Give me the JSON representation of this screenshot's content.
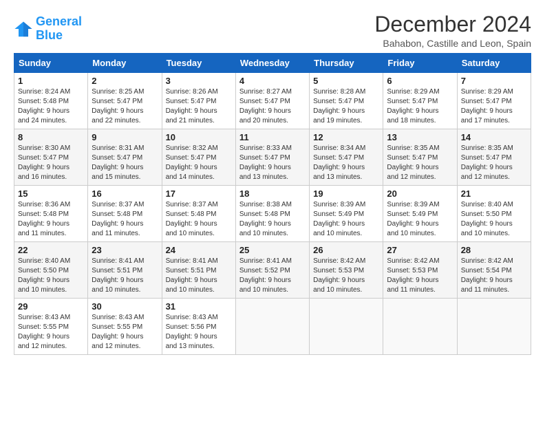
{
  "logo": {
    "line1": "General",
    "line2": "Blue"
  },
  "title": "December 2024",
  "subtitle": "Bahabon, Castille and Leon, Spain",
  "days_header": [
    "Sunday",
    "Monday",
    "Tuesday",
    "Wednesday",
    "Thursday",
    "Friday",
    "Saturday"
  ],
  "weeks": [
    [
      {
        "day": "1",
        "info": "Sunrise: 8:24 AM\nSunset: 5:48 PM\nDaylight: 9 hours\nand 24 minutes."
      },
      {
        "day": "2",
        "info": "Sunrise: 8:25 AM\nSunset: 5:47 PM\nDaylight: 9 hours\nand 22 minutes."
      },
      {
        "day": "3",
        "info": "Sunrise: 8:26 AM\nSunset: 5:47 PM\nDaylight: 9 hours\nand 21 minutes."
      },
      {
        "day": "4",
        "info": "Sunrise: 8:27 AM\nSunset: 5:47 PM\nDaylight: 9 hours\nand 20 minutes."
      },
      {
        "day": "5",
        "info": "Sunrise: 8:28 AM\nSunset: 5:47 PM\nDaylight: 9 hours\nand 19 minutes."
      },
      {
        "day": "6",
        "info": "Sunrise: 8:29 AM\nSunset: 5:47 PM\nDaylight: 9 hours\nand 18 minutes."
      },
      {
        "day": "7",
        "info": "Sunrise: 8:29 AM\nSunset: 5:47 PM\nDaylight: 9 hours\nand 17 minutes."
      }
    ],
    [
      {
        "day": "8",
        "info": "Sunrise: 8:30 AM\nSunset: 5:47 PM\nDaylight: 9 hours\nand 16 minutes."
      },
      {
        "day": "9",
        "info": "Sunrise: 8:31 AM\nSunset: 5:47 PM\nDaylight: 9 hours\nand 15 minutes."
      },
      {
        "day": "10",
        "info": "Sunrise: 8:32 AM\nSunset: 5:47 PM\nDaylight: 9 hours\nand 14 minutes."
      },
      {
        "day": "11",
        "info": "Sunrise: 8:33 AM\nSunset: 5:47 PM\nDaylight: 9 hours\nand 13 minutes."
      },
      {
        "day": "12",
        "info": "Sunrise: 8:34 AM\nSunset: 5:47 PM\nDaylight: 9 hours\nand 13 minutes."
      },
      {
        "day": "13",
        "info": "Sunrise: 8:35 AM\nSunset: 5:47 PM\nDaylight: 9 hours\nand 12 minutes."
      },
      {
        "day": "14",
        "info": "Sunrise: 8:35 AM\nSunset: 5:47 PM\nDaylight: 9 hours\nand 12 minutes."
      }
    ],
    [
      {
        "day": "15",
        "info": "Sunrise: 8:36 AM\nSunset: 5:48 PM\nDaylight: 9 hours\nand 11 minutes."
      },
      {
        "day": "16",
        "info": "Sunrise: 8:37 AM\nSunset: 5:48 PM\nDaylight: 9 hours\nand 11 minutes."
      },
      {
        "day": "17",
        "info": "Sunrise: 8:37 AM\nSunset: 5:48 PM\nDaylight: 9 hours\nand 10 minutes."
      },
      {
        "day": "18",
        "info": "Sunrise: 8:38 AM\nSunset: 5:48 PM\nDaylight: 9 hours\nand 10 minutes."
      },
      {
        "day": "19",
        "info": "Sunrise: 8:39 AM\nSunset: 5:49 PM\nDaylight: 9 hours\nand 10 minutes."
      },
      {
        "day": "20",
        "info": "Sunrise: 8:39 AM\nSunset: 5:49 PM\nDaylight: 9 hours\nand 10 minutes."
      },
      {
        "day": "21",
        "info": "Sunrise: 8:40 AM\nSunset: 5:50 PM\nDaylight: 9 hours\nand 10 minutes."
      }
    ],
    [
      {
        "day": "22",
        "info": "Sunrise: 8:40 AM\nSunset: 5:50 PM\nDaylight: 9 hours\nand 10 minutes."
      },
      {
        "day": "23",
        "info": "Sunrise: 8:41 AM\nSunset: 5:51 PM\nDaylight: 9 hours\nand 10 minutes."
      },
      {
        "day": "24",
        "info": "Sunrise: 8:41 AM\nSunset: 5:51 PM\nDaylight: 9 hours\nand 10 minutes."
      },
      {
        "day": "25",
        "info": "Sunrise: 8:41 AM\nSunset: 5:52 PM\nDaylight: 9 hours\nand 10 minutes."
      },
      {
        "day": "26",
        "info": "Sunrise: 8:42 AM\nSunset: 5:53 PM\nDaylight: 9 hours\nand 10 minutes."
      },
      {
        "day": "27",
        "info": "Sunrise: 8:42 AM\nSunset: 5:53 PM\nDaylight: 9 hours\nand 11 minutes."
      },
      {
        "day": "28",
        "info": "Sunrise: 8:42 AM\nSunset: 5:54 PM\nDaylight: 9 hours\nand 11 minutes."
      }
    ],
    [
      {
        "day": "29",
        "info": "Sunrise: 8:43 AM\nSunset: 5:55 PM\nDaylight: 9 hours\nand 12 minutes."
      },
      {
        "day": "30",
        "info": "Sunrise: 8:43 AM\nSunset: 5:55 PM\nDaylight: 9 hours\nand 12 minutes."
      },
      {
        "day": "31",
        "info": "Sunrise: 8:43 AM\nSunset: 5:56 PM\nDaylight: 9 hours\nand 13 minutes."
      },
      null,
      null,
      null,
      null
    ]
  ]
}
